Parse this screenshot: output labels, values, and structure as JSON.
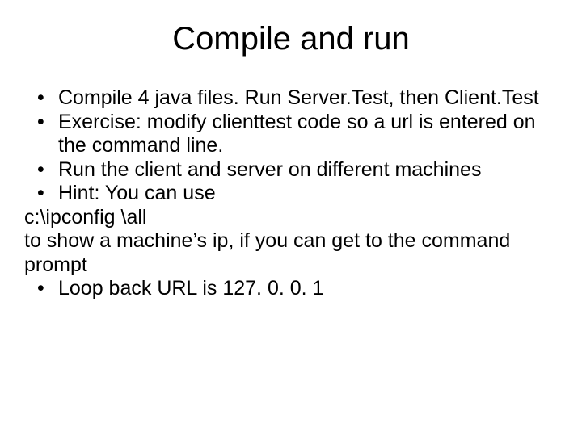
{
  "title": "Compile and run",
  "items": {
    "b1": "Compile 4 java files. Run Server.Test, then Client.Test",
    "b2": "Exercise: modify clienttest code so a url is entered on the command line.",
    "b3": "Run the client and server on different machines",
    "b4": "Hint: You can use",
    "l5": "c:\\ipconfig \\all",
    "l6": "to show a machine’s ip, if you can get to the command prompt",
    "b7": "Loop back URL is 127. 0. 0. 1"
  }
}
